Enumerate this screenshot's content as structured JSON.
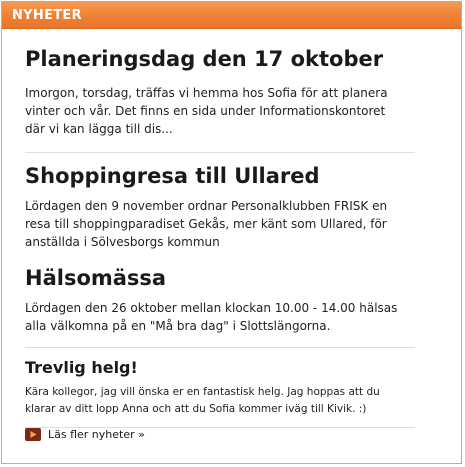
{
  "header": {
    "title": "NYHETER"
  },
  "articles": [
    {
      "title": "Planeringsdag den 17 oktober",
      "lines": [
        "Imorgon, torsdag, träffas vi hemma hos Sofia för att planera",
        "vinter och vår. Det finns en sida under Informationskontoret",
        "där vi kan lägga till dis..."
      ]
    },
    {
      "title": "Shoppingresa till Ullared",
      "lines": [
        "Lördagen den 9 november ordnar Personalklubben FRISK en",
        "resa till shoppingparadiset Gekås, mer känt som Ullared, för",
        "anställda i Sölvesborgs kommun"
      ]
    },
    {
      "title": "Hälsomässa",
      "lines": [
        "Lördagen den 26 oktober mellan klockan 10.00 - 14.00 hälsas",
        "alla välkomna på en \"Må bra dag\" i Slottslängorna."
      ]
    },
    {
      "title": "Trevlig helg!",
      "lines": [
        "Kära kollegor, jag vill önska er en fantastisk helg. Jag hoppas att du",
        "klarar av ditt lopp Anna och att du Sofia kommer iväg till Kivik. :)"
      ]
    }
  ],
  "more_link": {
    "label": "Läs fler nyheter »",
    "icon": "play-arrow-icon",
    "icon_color": "#7a2a10"
  },
  "colors": {
    "header_bg": "#ee8034",
    "border": "#e4a070",
    "divider": "#e8ddd5"
  }
}
